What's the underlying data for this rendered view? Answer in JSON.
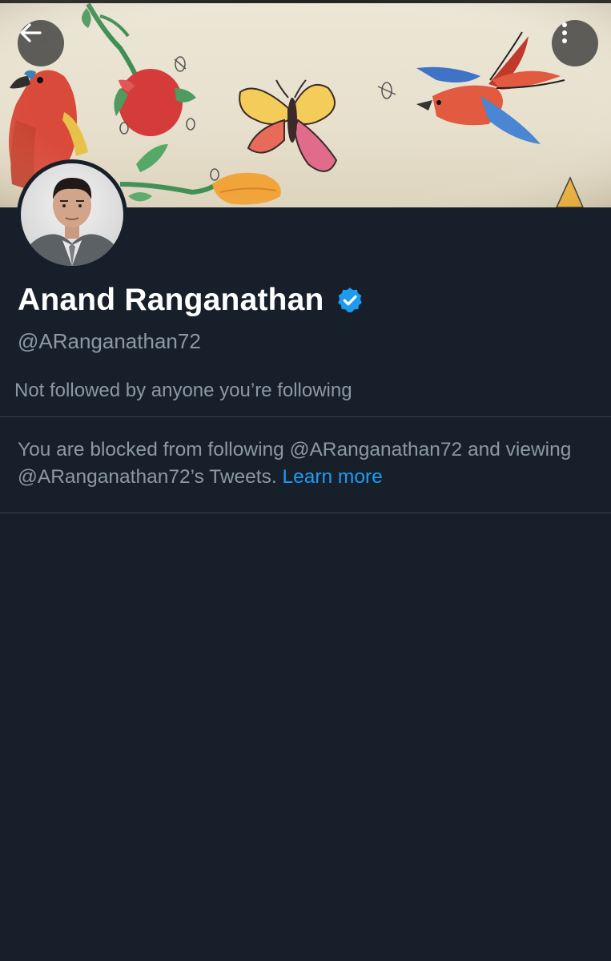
{
  "header": {
    "back_icon": "arrow-left-icon",
    "more_icon": "vertical-dots-icon"
  },
  "profile": {
    "display_name": "Anand Ranganathan",
    "verified_icon": "verified-badge-icon",
    "verified_color": "#1d9bf0",
    "handle": "@ARanganathan72",
    "followed_by": "Not followed by anyone you’re following"
  },
  "blocked": {
    "message": "You are blocked from following @ARanganathan72 and viewing @ARanganathan72’s Tweets.",
    "link_label": "Learn more",
    "link_color": "#1d9bf0"
  },
  "theme": {
    "background": "#17202a",
    "secondary_text": "#8b98a5",
    "divider": "#38444d"
  }
}
